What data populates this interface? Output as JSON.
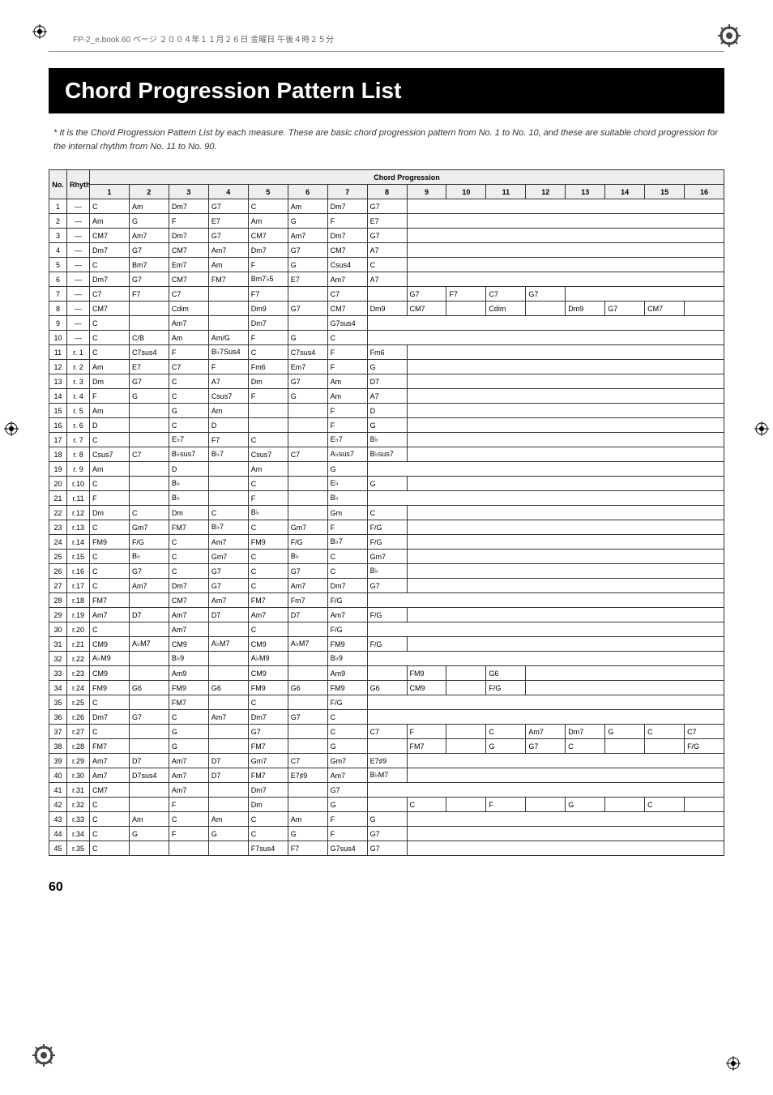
{
  "header_line": "FP-2_e.book 60 ページ ２００４年１１月２６日 金曜日 午後４時２５分",
  "title": "Chord Progression Pattern List",
  "note_text": "* It is the Chord Progression Pattern List by each measure. These are basic chord progression pattern from No. 1 to No. 10, and these are suitable chord progression for the internal rhythm from No. 11 to No. 90.",
  "page_number": "60",
  "table": {
    "headers": {
      "no": "No.",
      "rhythm": "Rhythm No.",
      "chord_progression": "Chord Progression",
      "cols": [
        "1",
        "2",
        "3",
        "4",
        "5",
        "6",
        "7",
        "8",
        "9",
        "10",
        "11",
        "12",
        "13",
        "14",
        "15",
        "16"
      ]
    },
    "rows": [
      {
        "no": "1",
        "r": "—",
        "c": [
          "C",
          "Am",
          "Dm7",
          "G7",
          "C",
          "Am",
          "Dm7",
          "G7"
        ]
      },
      {
        "no": "2",
        "r": "—",
        "c": [
          "Am",
          "G",
          "F",
          "E7",
          "Am",
          "G",
          "F",
          "E7"
        ]
      },
      {
        "no": "3",
        "r": "—",
        "c": [
          "CM7",
          "Am7",
          "Dm7",
          "G7",
          "CM7",
          "Am7",
          "Dm7",
          "G7"
        ]
      },
      {
        "no": "4",
        "r": "—",
        "c": [
          "Dm7",
          "G7",
          "CM7",
          "Am7",
          "Dm7",
          "G7",
          "CM7",
          "A7"
        ]
      },
      {
        "no": "5",
        "r": "—",
        "c": [
          "C",
          "Bm7",
          "Em7",
          "Am",
          "F",
          "G",
          "Csus4",
          "C"
        ]
      },
      {
        "no": "6",
        "r": "—",
        "c": [
          "Dm7",
          "G7",
          "CM7",
          "FM7",
          "Bm7♭5",
          "E7",
          "Am7",
          "A7"
        ]
      },
      {
        "no": "7",
        "r": "—",
        "c": [
          "C7",
          "F7",
          "C7",
          "",
          "F7",
          "",
          "C7",
          "",
          "G7",
          "F7",
          "C7",
          "G7"
        ]
      },
      {
        "no": "8",
        "r": "—",
        "c": [
          "CM7",
          "",
          "Cdim",
          "",
          "Dm9",
          "G7",
          "CM7",
          "Dm9",
          "CM7",
          "",
          "Cdim",
          "",
          "Dm9",
          "G7",
          "CM7"
        ]
      },
      {
        "no": "9",
        "r": "—",
        "c": [
          "C",
          "",
          "Am7",
          "",
          "Dm7",
          "",
          "G7sus4"
        ]
      },
      {
        "no": "10",
        "r": "—",
        "c": [
          "C",
          "C/B",
          "Am",
          "Am/G",
          "F",
          "G",
          "C"
        ]
      },
      {
        "no": "11",
        "r": "r. 1",
        "c": [
          "C",
          "C7sus4",
          "F",
          "B♭7Sus4",
          "C",
          "C7sus4",
          "F",
          "Fm6"
        ]
      },
      {
        "no": "12",
        "r": "r. 2",
        "c": [
          "Am",
          "E7",
          "C7",
          "F",
          "Fm6",
          "Em7",
          "F",
          "G"
        ]
      },
      {
        "no": "13",
        "r": "r. 3",
        "c": [
          "Dm",
          "G7",
          "C",
          "A7",
          "Dm",
          "G7",
          "Am",
          "D7"
        ]
      },
      {
        "no": "14",
        "r": "r. 4",
        "c": [
          "F",
          "G",
          "C",
          "Csus7",
          "F",
          "G",
          "Am",
          "A7"
        ]
      },
      {
        "no": "15",
        "r": "r. 5",
        "c": [
          "Am",
          "",
          "G",
          "Am",
          "",
          "",
          "F",
          "D"
        ]
      },
      {
        "no": "16",
        "r": "r. 6",
        "c": [
          "D",
          "",
          "C",
          "D",
          "",
          "",
          "F",
          "G"
        ]
      },
      {
        "no": "17",
        "r": "r. 7",
        "c": [
          "C",
          "",
          "E♭7",
          "F7",
          "C",
          "",
          "E♭7",
          "B♭"
        ]
      },
      {
        "no": "18",
        "r": "r. 8",
        "c": [
          "Csus7",
          "C7",
          "B♭sus7",
          "B♭7",
          "Csus7",
          "C7",
          "A♭sus7",
          "B♭sus7"
        ]
      },
      {
        "no": "19",
        "r": "r. 9",
        "c": [
          "Am",
          "",
          "D",
          "",
          "Am",
          "",
          "G"
        ]
      },
      {
        "no": "20",
        "r": "r.10",
        "c": [
          "C",
          "",
          "B♭",
          "",
          "C",
          "",
          "E♭",
          "G"
        ]
      },
      {
        "no": "21",
        "r": "r.11",
        "c": [
          "F",
          "",
          "B♭",
          "",
          "F",
          "",
          "B♭"
        ]
      },
      {
        "no": "22",
        "r": "r.12",
        "c": [
          "Dm",
          "C",
          "Dm",
          "C",
          "B♭",
          "",
          "Gm",
          "C"
        ]
      },
      {
        "no": "23",
        "r": "r.13",
        "c": [
          "C",
          "Gm7",
          "FM7",
          "B♭7",
          "C",
          "Gm7",
          "F",
          "F/G"
        ]
      },
      {
        "no": "24",
        "r": "r.14",
        "c": [
          "FM9",
          "F/G",
          "C",
          "Am7",
          "FM9",
          "F/G",
          "B♭7",
          "F/G"
        ]
      },
      {
        "no": "25",
        "r": "r.15",
        "c": [
          "C",
          "B♭",
          "C",
          "Gm7",
          "C",
          "B♭",
          "C",
          "Gm7"
        ]
      },
      {
        "no": "26",
        "r": "r.16",
        "c": [
          "C",
          "G7",
          "C",
          "G7",
          "C",
          "G7",
          "C",
          "B♭"
        ]
      },
      {
        "no": "27",
        "r": "r.17",
        "c": [
          "C",
          "Am7",
          "Dm7",
          "G7",
          "C",
          "Am7",
          "Dm7",
          "G7"
        ]
      },
      {
        "no": "28",
        "r": "r.18",
        "c": [
          "FM7",
          "",
          "CM7",
          "Am7",
          "FM7",
          "Fm7",
          "F/G"
        ]
      },
      {
        "no": "29",
        "r": "r.19",
        "c": [
          "Am7",
          "D7",
          "Am7",
          "D7",
          "Am7",
          "D7",
          "Am7",
          "F/G"
        ]
      },
      {
        "no": "30",
        "r": "r.20",
        "c": [
          "C",
          "",
          "Am7",
          "",
          "C",
          "",
          "F/G"
        ]
      },
      {
        "no": "31",
        "r": "r.21",
        "c": [
          "CM9",
          "A♭M7",
          "CM9",
          "A♭M7",
          "CM9",
          "A♭M7",
          "FM9",
          "F/G"
        ]
      },
      {
        "no": "32",
        "r": "r.22",
        "c": [
          "A♭M9",
          "",
          "B♭9",
          "",
          "A♭M9",
          "",
          "B♭9"
        ]
      },
      {
        "no": "33",
        "r": "r.23",
        "c": [
          "CM9",
          "",
          "Am9",
          "",
          "CM9",
          "",
          "Am9",
          "",
          "FM9",
          "",
          "G6"
        ]
      },
      {
        "no": "34",
        "r": "r.24",
        "c": [
          "FM9",
          "G6",
          "FM9",
          "G6",
          "FM9",
          "G6",
          "FM9",
          "G6",
          "CM9",
          "",
          "F/G"
        ]
      },
      {
        "no": "35",
        "r": "r.25",
        "c": [
          "C",
          "",
          "FM7",
          "",
          "C",
          "",
          "F/G"
        ]
      },
      {
        "no": "36",
        "r": "r.26",
        "c": [
          "Dm7",
          "G7",
          "C",
          "Am7",
          "Dm7",
          "G7",
          "C"
        ]
      },
      {
        "no": "37",
        "r": "r.27",
        "c": [
          "C",
          "",
          "G",
          "",
          "G7",
          "",
          "C",
          "C7",
          "F",
          "",
          "C",
          "Am7",
          "Dm7",
          "G",
          "C",
          "C7"
        ]
      },
      {
        "no": "38",
        "r": "r.28",
        "c": [
          "FM7",
          "",
          "G",
          "",
          "FM7",
          "",
          "G",
          "",
          "FM7",
          "",
          "G",
          "G7",
          "C",
          "",
          "",
          "F/G"
        ]
      },
      {
        "no": "39",
        "r": "r.29",
        "c": [
          "Am7",
          "D7",
          "Am7",
          "D7",
          "Gm7",
          "C7",
          "Gm7",
          "E7♯9"
        ]
      },
      {
        "no": "40",
        "r": "r.30",
        "c": [
          "Am7",
          "D7sus4",
          "Am7",
          "D7",
          "FM7",
          "E7♯9",
          "Am7",
          "B♭M7"
        ]
      },
      {
        "no": "41",
        "r": "r.31",
        "c": [
          "CM7",
          "",
          "Am7",
          "",
          "Dm7",
          "",
          "G7"
        ]
      },
      {
        "no": "42",
        "r": "r.32",
        "c": [
          "C",
          "",
          "F",
          "",
          "Dm",
          "",
          "G",
          "",
          "C",
          "",
          "F",
          "",
          "G",
          "",
          "C"
        ]
      },
      {
        "no": "43",
        "r": "r.33",
        "c": [
          "C",
          "Am",
          "C",
          "Am",
          "C",
          "Am",
          "F",
          "G"
        ]
      },
      {
        "no": "44",
        "r": "r.34",
        "c": [
          "C",
          "G",
          "F",
          "G",
          "C",
          "G",
          "F",
          "G7"
        ]
      },
      {
        "no": "45",
        "r": "r.35",
        "c": [
          "C",
          "",
          "",
          "",
          "F7sus4",
          "F7",
          "G7sus4",
          "G7"
        ]
      }
    ]
  }
}
